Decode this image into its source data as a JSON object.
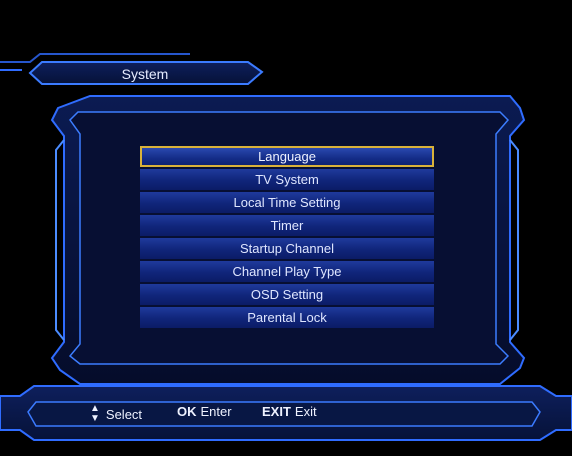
{
  "screen": {
    "title": "System"
  },
  "menu": {
    "items": [
      {
        "label": "Language",
        "selected": true
      },
      {
        "label": "TV System"
      },
      {
        "label": "Local Time Setting"
      },
      {
        "label": "Timer"
      },
      {
        "label": "Startup Channel"
      },
      {
        "label": "Channel Play Type"
      },
      {
        "label": "OSD Setting"
      },
      {
        "label": "Parental Lock"
      }
    ]
  },
  "footer": {
    "select_label": "Select",
    "ok_key": "OK",
    "ok_label": "Enter",
    "exit_key": "EXIT",
    "exit_label": "Exit"
  },
  "colors": {
    "frame_blue": "#2f6cff",
    "panel": "#0a1640",
    "item": "#15307f",
    "selection_border": "#d9b23a"
  }
}
